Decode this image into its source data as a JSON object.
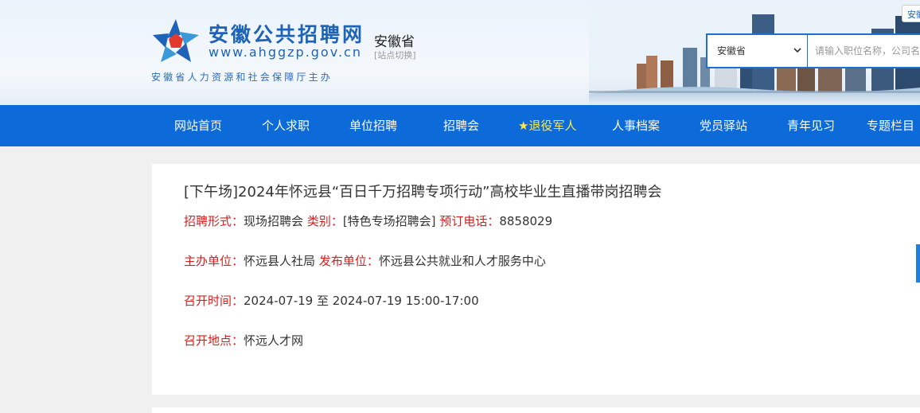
{
  "header": {
    "site_title": "安徽公共招聘网",
    "site_url": "www.ahggzp.gov.cn",
    "region_name": "安徽省",
    "region_switch": "[站点切换]",
    "host_line": "安徽省人力资源和社会保障厅主办",
    "corner_tag": "安徽"
  },
  "search": {
    "selected_region": "安徽省",
    "keyword_placeholder": "请输入职位名称，公司名称"
  },
  "nav": {
    "items": [
      {
        "label": "网站首页"
      },
      {
        "label": "个人求职"
      },
      {
        "label": "单位招聘"
      },
      {
        "label": "招聘会"
      },
      {
        "label": "★退役军人"
      },
      {
        "label": "人事档案"
      },
      {
        "label": "党员驿站"
      },
      {
        "label": "青年见习"
      },
      {
        "label": "专题栏目"
      }
    ]
  },
  "fair": {
    "title": "[下午场]2024年怀远县“百日千万招聘专项行动”高校毕业生直播带岗招聘会",
    "form_label": "招聘形式：",
    "form_value": "现场招聘会",
    "category_label": "类别：",
    "category_value": "[特色专场招聘会]",
    "phone_label": "预订电话：",
    "phone_value": "8858029",
    "organizer_label": "主办单位：",
    "organizer_value": "怀远县人社局",
    "publisher_label": "发布单位：",
    "publisher_value": "怀远县公共就业和人才服务中心",
    "time_label": "召开时间：",
    "start_date": "2024-07-19",
    "to_text": "至",
    "end_date": "2024-07-19",
    "time_range": "15:00-17:00",
    "location_label": "召开地点：",
    "location_value": "怀远人才网"
  },
  "colors": {
    "nav_bg": "#0c6ad9",
    "brand_blue": "#1d63b8",
    "label_red": "#d81e1e",
    "veteran_highlight": "#ffe74a"
  }
}
